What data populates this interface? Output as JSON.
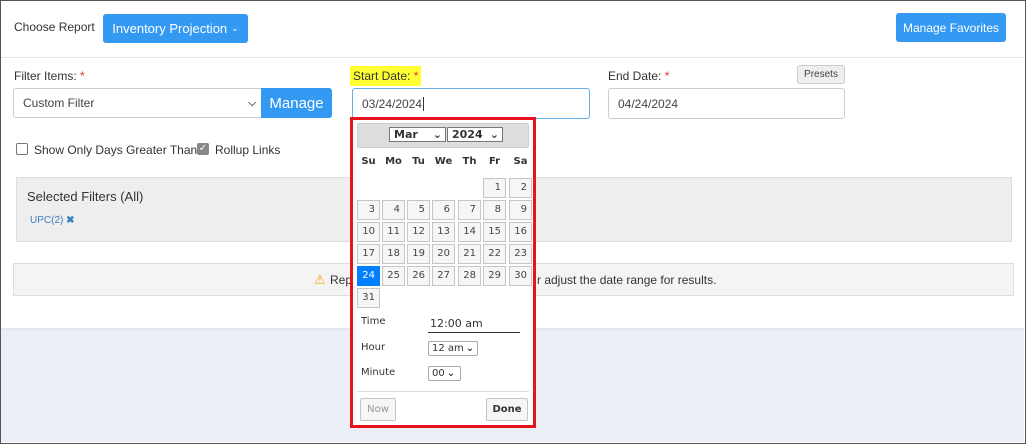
{
  "header": {
    "choose_report_label": "Choose Report",
    "report_button": "Inventory Projection",
    "manage_favorites": "Manage Favorites"
  },
  "filter_items": {
    "label": "Filter Items:",
    "required": "*",
    "value": "Custom Filter",
    "manage_button": "Manage"
  },
  "start_date": {
    "label": "Start Date:",
    "required": "*",
    "value": "03/24/2024"
  },
  "end_date": {
    "label": "End Date:",
    "required": "*",
    "value": "04/24/2024",
    "presets_button": "Presets"
  },
  "options": {
    "show_days": {
      "label": "Show Only Days Greater Than",
      "checked": false
    },
    "rollup": {
      "label": "Rollup Links",
      "checked": true
    }
  },
  "selected_filters": {
    "title": "Selected Filters (All)",
    "tags": [
      {
        "label": "UPC(2)"
      }
    ]
  },
  "warning": {
    "text_left": "Rep",
    "text_right": "r adjust the date range for results."
  },
  "datepicker": {
    "month": "Mar",
    "year": "2024",
    "weekdays": [
      "Su",
      "Mo",
      "Tu",
      "We",
      "Th",
      "Fr",
      "Sa"
    ],
    "selected_day": 24,
    "time_label": "Time",
    "time_value": "12:00 am",
    "hour_label": "Hour",
    "hour_value": "12 am",
    "minute_label": "Minute",
    "minute_value": "00",
    "now_button": "Now",
    "done_button": "Done"
  },
  "colors": {
    "accent": "#3399f3",
    "highlight": "#ffff33",
    "popup_border": "#e8121d",
    "selected_day": "#007fff"
  }
}
